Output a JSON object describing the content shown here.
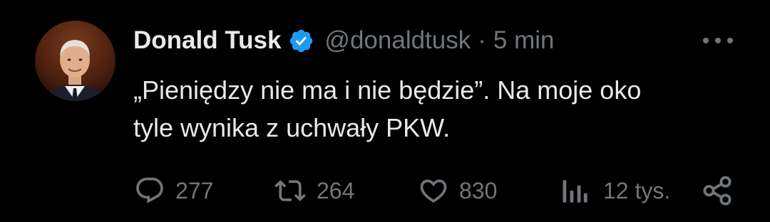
{
  "tweet": {
    "author": {
      "display_name": "Donald Tusk",
      "handle": "@donaldtusk",
      "verified": true
    },
    "separator": "·",
    "time": "5 min",
    "text_lines": [
      "„Pieniędzy nie ma i nie będzie”. Na moje oko",
      "tyle wynika z uchwały PKW."
    ],
    "actions": {
      "replies": "277",
      "reposts": "264",
      "likes": "830",
      "views": "12 tys."
    }
  },
  "icons": {
    "more": "more-horizontal-icon",
    "verified": "verified-badge-icon",
    "reply": "reply-icon",
    "repost": "repost-icon",
    "like": "heart-icon",
    "views": "views-bar-chart-icon",
    "share": "share-icon"
  },
  "colors": {
    "background": "#000000",
    "primary_text": "#e7e9ea",
    "secondary_text": "#71767b",
    "verified_blue": "#1d9bf0"
  }
}
